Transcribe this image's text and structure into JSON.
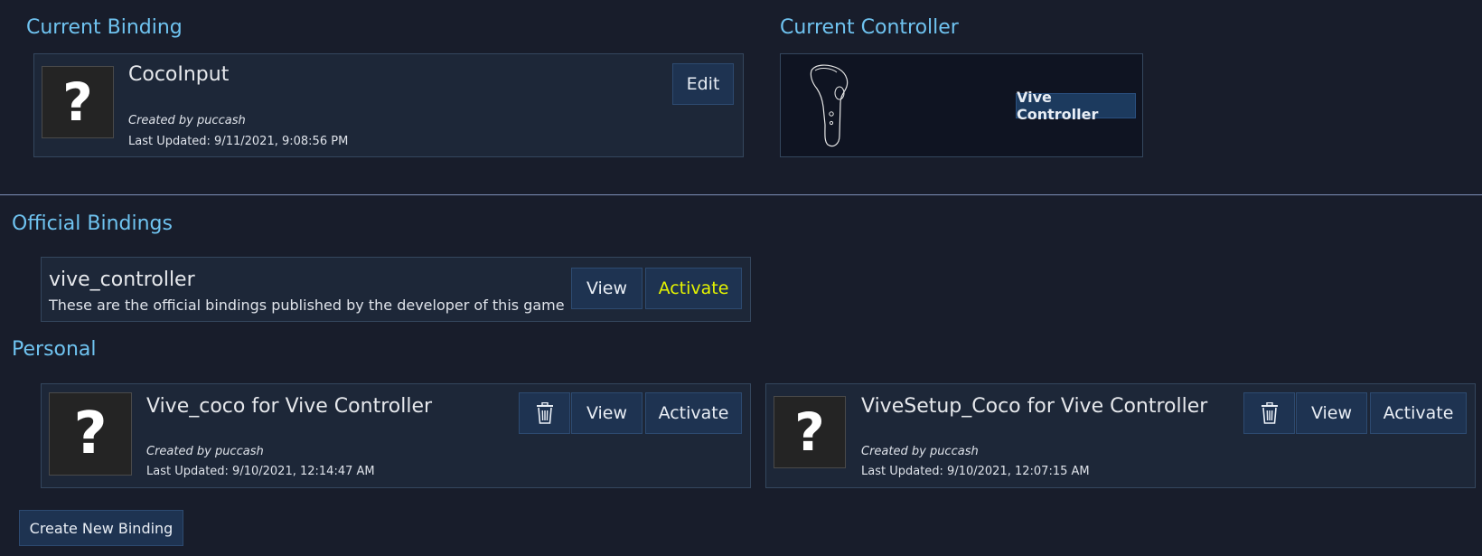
{
  "current_binding": {
    "heading": "Current Binding",
    "name": "CocoInput",
    "created_by": "Created by puccash",
    "last_updated": "Last Updated: 9/11/2021, 9:08:56 PM",
    "edit_label": "Edit",
    "thumb_glyph": "?"
  },
  "current_controller": {
    "heading": "Current Controller",
    "controller_label": "Vive Controller",
    "image_icon": "vive-controller-outline"
  },
  "official": {
    "heading": "Official Bindings",
    "name": "vive_controller",
    "description": "These are the official bindings published by the developer of this game",
    "view_label": "View",
    "activate_label": "Activate",
    "activate_highlight_color": "#e5f400"
  },
  "personal": {
    "heading": "Personal",
    "items": [
      {
        "name": "Vive_coco for Vive Controller",
        "created_by": "Created by puccash",
        "last_updated": "Last Updated: 9/10/2021, 12:14:47 AM",
        "view_label": "View",
        "activate_label": "Activate",
        "thumb_glyph": "?",
        "delete_icon": "trash-icon"
      },
      {
        "name": "ViveSetup_Coco for Vive Controller",
        "created_by": "Created by puccash",
        "last_updated": "Last Updated: 9/10/2021, 12:07:15 AM",
        "view_label": "View",
        "activate_label": "Activate",
        "thumb_glyph": "?",
        "delete_icon": "trash-icon"
      }
    ]
  },
  "create_new_label": "Create New Binding",
  "colors": {
    "background": "#181d2b",
    "panel": "#1d2738",
    "heading": "#6fc3f0",
    "button": "#1e3351"
  }
}
